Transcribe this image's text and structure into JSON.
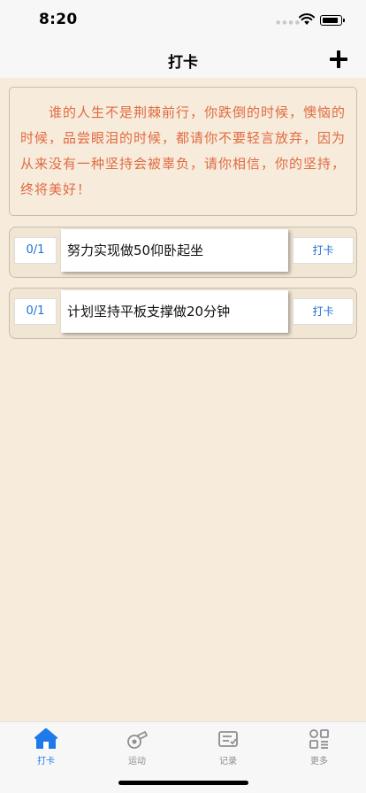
{
  "status_bar": {
    "time": "8:20"
  },
  "nav": {
    "title": "打卡"
  },
  "quote": {
    "text": "谁的人生不是荆棘前行，你跌倒的时候，懊恼的时候，品尝眼泪的时候，都请你不要轻言放弃，因为从来没有一种坚持会被辜负，请你相信，你的坚持，终将美好！"
  },
  "tasks": [
    {
      "count": "0/1",
      "name": "努力实现做50仰卧起坐",
      "button": "打卡"
    },
    {
      "count": "0/1",
      "name": "计划坚持平板支撑做20分钟",
      "button": "打卡"
    }
  ],
  "tabs": [
    {
      "label": "打卡",
      "icon": "home-icon",
      "active": true
    },
    {
      "label": "运动",
      "icon": "whistle-icon",
      "active": false
    },
    {
      "label": "记录",
      "icon": "ticket-icon",
      "active": false
    },
    {
      "label": "更多",
      "icon": "grid-menu-icon",
      "active": false
    }
  ],
  "colors": {
    "background": "#f7ecdc",
    "quote_text": "#e06a40",
    "accent": "#1e6fd6",
    "tab_active": "#1e7ae8",
    "tab_inactive": "#8e8e93"
  }
}
